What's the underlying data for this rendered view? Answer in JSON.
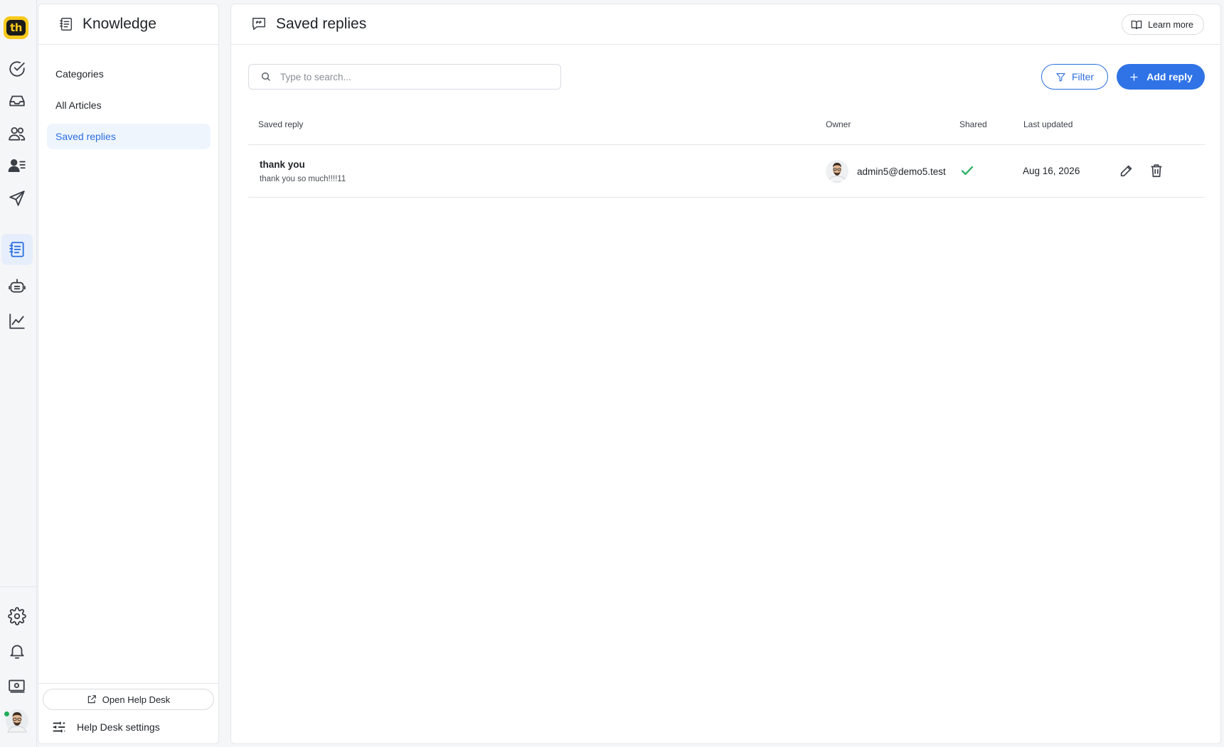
{
  "rail": {
    "logo_text": "th",
    "items": [
      {
        "name": "tasks",
        "icon": "check-circle-icon"
      },
      {
        "name": "inbox",
        "icon": "inbox-icon"
      },
      {
        "name": "contacts",
        "icon": "users-icon"
      },
      {
        "name": "customers",
        "icon": "user-list-icon"
      },
      {
        "name": "campaigns",
        "icon": "send-icon"
      },
      {
        "name": "knowledge",
        "icon": "knowledge-icon",
        "active": true
      },
      {
        "name": "bots",
        "icon": "bot-icon"
      },
      {
        "name": "reports",
        "icon": "chart-icon"
      }
    ],
    "bottom_items": [
      {
        "name": "settings",
        "icon": "gear-icon"
      },
      {
        "name": "notifications",
        "icon": "bell-icon"
      },
      {
        "name": "billing",
        "icon": "billing-icon"
      }
    ]
  },
  "knowledge": {
    "title": "Knowledge",
    "nav": [
      "Categories",
      "All Articles",
      "Saved replies"
    ],
    "active_nav": "Saved replies",
    "open_help_desk": "Open Help Desk",
    "help_desk_settings": "Help Desk settings"
  },
  "main": {
    "title": "Saved replies",
    "learn_more": "Learn more",
    "search_placeholder": "Type to search...",
    "filter_label": "Filter",
    "add_label": "Add reply",
    "columns": {
      "reply": "Saved reply",
      "owner": "Owner",
      "shared": "Shared",
      "updated": "Last updated"
    },
    "rows": [
      {
        "title": "thank you",
        "body": "thank you so much!!!!11",
        "owner": "admin5@demo5.test",
        "shared": true,
        "updated": "Aug 16, 2026"
      }
    ]
  },
  "colors": {
    "accent": "#2f73e6",
    "success": "#1fae5a",
    "logo": "#f7c91b"
  }
}
